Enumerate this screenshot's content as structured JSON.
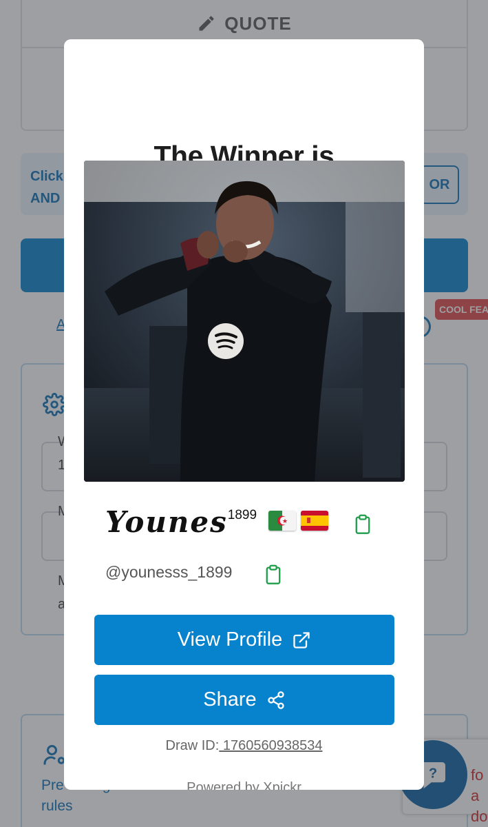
{
  "background": {
    "quote_label": "QUOTE",
    "info_text_line1": "Click",
    "info_text_line2": "AND",
    "or_label": "OR",
    "link_text": "A",
    "cool_badge": "COOL FEA",
    "field_label_1": "W",
    "field_value_1": "1",
    "field_label_2": "M",
    "hint_line1": "M",
    "hint_line2": "a",
    "rules_text": "Pre          setting rules",
    "chat_text_line1": "fo",
    "chat_text_line2": "a do"
  },
  "modal": {
    "title": "The Winner is",
    "winner_display_name": "Younes",
    "winner_superscript": "1899",
    "flags": [
      "algeria-flag",
      "spain-flag"
    ],
    "handle": "@younesss_1899",
    "view_profile_label": "View Profile",
    "share_label": "Share",
    "draw_id_label": "Draw ID:",
    "draw_id_value": " 1760560938534",
    "powered_by": "Powered by Xpickr"
  },
  "colors": {
    "primary": "#0782cc",
    "copy_icon": "#1f9d4a",
    "badge_red": "#e04646"
  }
}
